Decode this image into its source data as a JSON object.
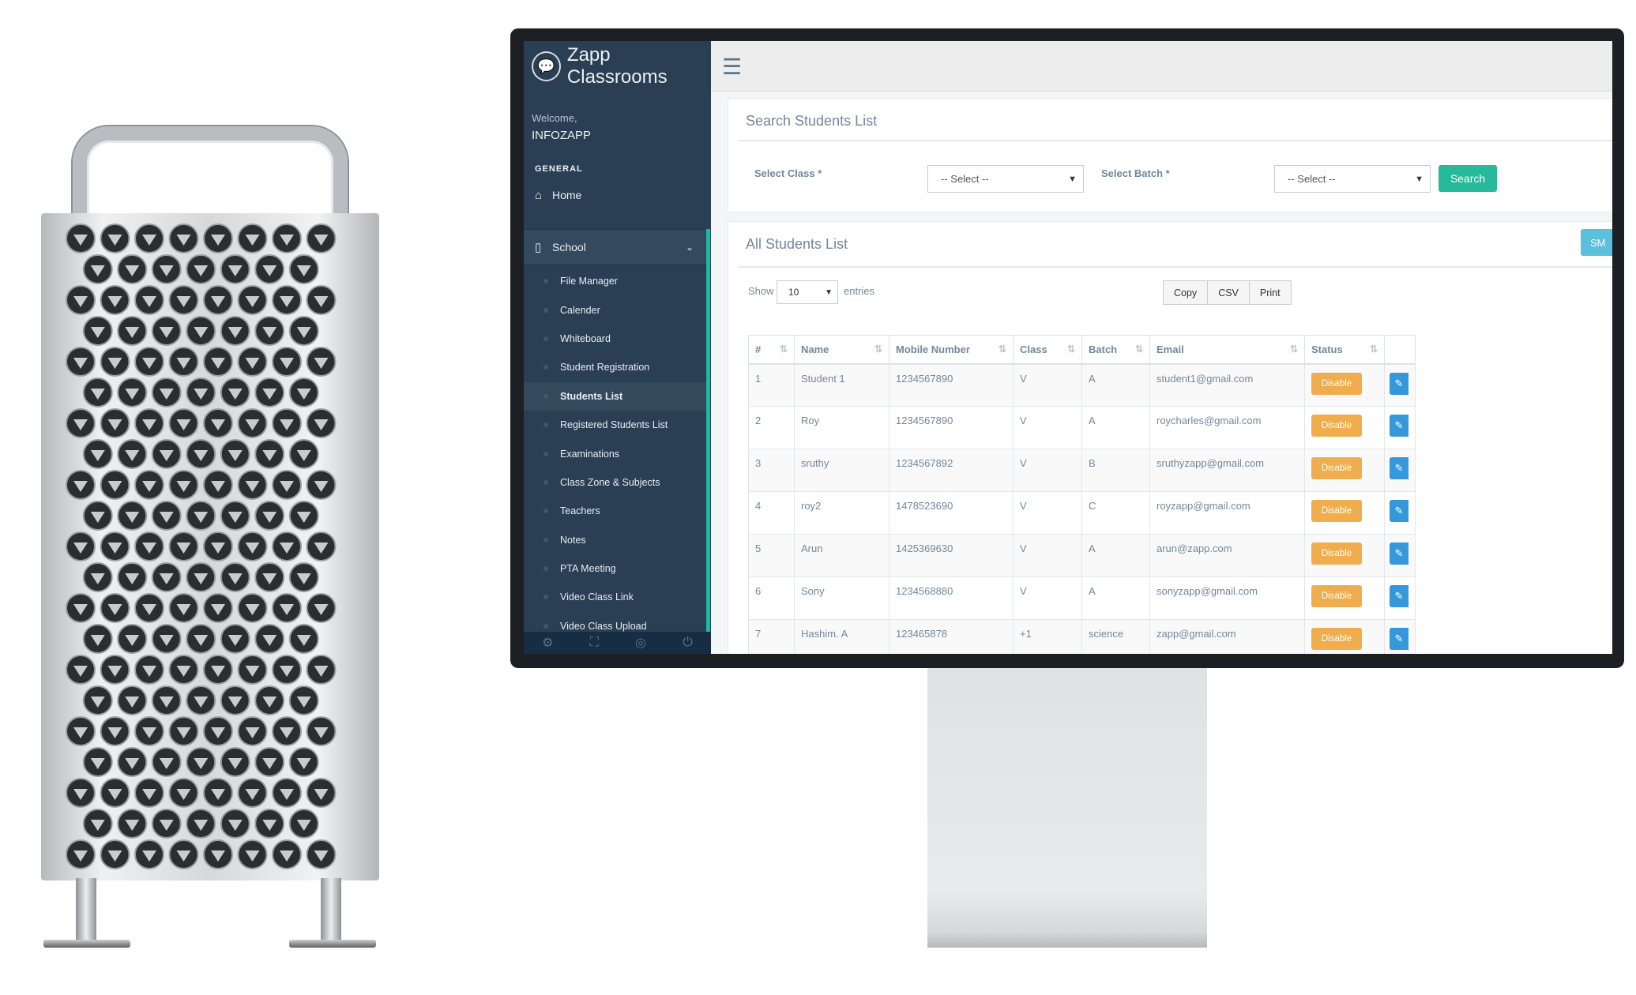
{
  "app": {
    "brand_logo_glyph": "💬",
    "title": "Zapp Classrooms"
  },
  "sidebar": {
    "welcome": "Welcome,",
    "user": "INFOZAPP",
    "section": "GENERAL",
    "home": {
      "label": "Home",
      "icon": "home-icon"
    },
    "school": {
      "label": "School",
      "icon": "book-icon"
    },
    "items": [
      {
        "label": "File Manager"
      },
      {
        "label": "Calender"
      },
      {
        "label": "Whiteboard"
      },
      {
        "label": "Student Registration"
      },
      {
        "label": "Students List"
      },
      {
        "label": "Registered Students List"
      },
      {
        "label": "Examinations"
      },
      {
        "label": "Class Zone & Subjects"
      },
      {
        "label": "Teachers"
      },
      {
        "label": "Notes"
      },
      {
        "label": "PTA Meeting"
      },
      {
        "label": "Video Class Link"
      },
      {
        "label": "Video Class Upload"
      }
    ],
    "active_index": 4,
    "footer_icons": [
      "gear-icon",
      "fullscreen-icon",
      "eye-slash-icon",
      "power-icon"
    ]
  },
  "search_panel": {
    "title": "Search Students List",
    "class_label": "Select Class *",
    "class_value": "-- Select --",
    "batch_label": "Select Batch *",
    "batch_value": "-- Select --",
    "search_button": "Search"
  },
  "list_panel": {
    "title": "All Students List",
    "sms_button": "SM",
    "show_label": "Show",
    "entries_value": "10",
    "entries_label": "entries",
    "export_buttons": [
      "Copy",
      "CSV",
      "Print"
    ]
  },
  "table": {
    "columns": [
      "#",
      "Name",
      "Mobile Number",
      "Class",
      "Batch",
      "Email",
      "Status",
      ""
    ],
    "status_label": "Disable",
    "rows": [
      {
        "n": "1",
        "name": "Student 1",
        "mobile": "1234567890",
        "class": "V",
        "batch": "A",
        "email": "student1@gmail.com"
      },
      {
        "n": "2",
        "name": "Roy",
        "mobile": "1234567890",
        "class": "V",
        "batch": "A",
        "email": "roycharles@gmail.com"
      },
      {
        "n": "3",
        "name": "sruthy",
        "mobile": "1234567892",
        "class": "V",
        "batch": "B",
        "email": "sruthyzapp@gmail.com"
      },
      {
        "n": "4",
        "name": "roy2",
        "mobile": "1478523690",
        "class": "V",
        "batch": "C",
        "email": "royzapp@gmail.com"
      },
      {
        "n": "5",
        "name": "Arun",
        "mobile": "1425369630",
        "class": "V",
        "batch": "A",
        "email": "arun@zapp.com"
      },
      {
        "n": "6",
        "name": "Sony",
        "mobile": "1234568880",
        "class": "V",
        "batch": "A",
        "email": "sonyzapp@gmail.com"
      },
      {
        "n": "7",
        "name": "Hashim. A",
        "mobile": "123465878",
        "class": "+1",
        "batch": "science",
        "email": "zapp@gmail.com"
      }
    ]
  },
  "colors": {
    "sidebar": "#2a3f54",
    "accent_teal": "#1abb9c",
    "search_button": "#26b99a",
    "disable_badge": "#f0ad4e",
    "edit_button": "#3498db",
    "sms_button": "#5bc0de"
  }
}
